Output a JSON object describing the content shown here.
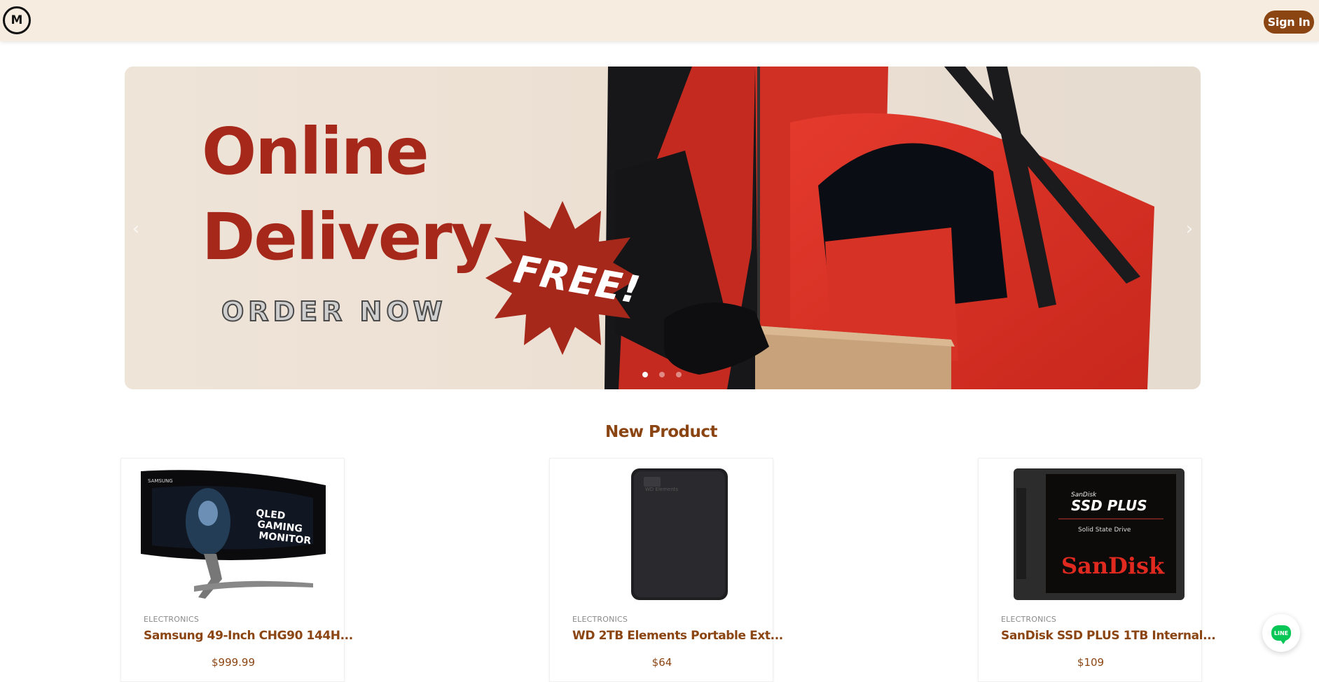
{
  "header": {
    "logo_letter": "M",
    "signin_label": "Sign In"
  },
  "banner": {
    "headline_line1": "Online",
    "headline_line2": "Delivery",
    "cta_text": "ORDER NOW",
    "badge_text": "FREE!",
    "prev_icon": "chevron-left-icon",
    "next_icon": "chevron-right-icon",
    "slide_count": 3,
    "active_slide": 1
  },
  "section": {
    "title": "New Product"
  },
  "products": [
    {
      "category": "ELECTRONICS",
      "name": "Samsung 49-Inch CHG90 144H...",
      "price": "$999.99",
      "image_text": [
        "SAMSUNG",
        "QLED",
        "GAMING",
        "MONITOR"
      ]
    },
    {
      "category": "ELECTRONICS",
      "name": "WD 2TB Elements Portable Ext...",
      "price": "$64",
      "image_text": [
        "WD Elements"
      ]
    },
    {
      "category": "ELECTRONICS",
      "name": "SanDisk SSD PLUS 1TB Internal...",
      "price": "$109",
      "image_text": [
        "SanDisk",
        "SSD PLUS",
        "Solid State Drive",
        "SanDisk"
      ]
    }
  ],
  "chat": {
    "icon": "line-chat-icon",
    "label": "LINE",
    "color": "#06c755"
  },
  "colors": {
    "brand": "#8b4513",
    "banner_red": "#a5281a",
    "header_bg": "#f6ecdf"
  }
}
